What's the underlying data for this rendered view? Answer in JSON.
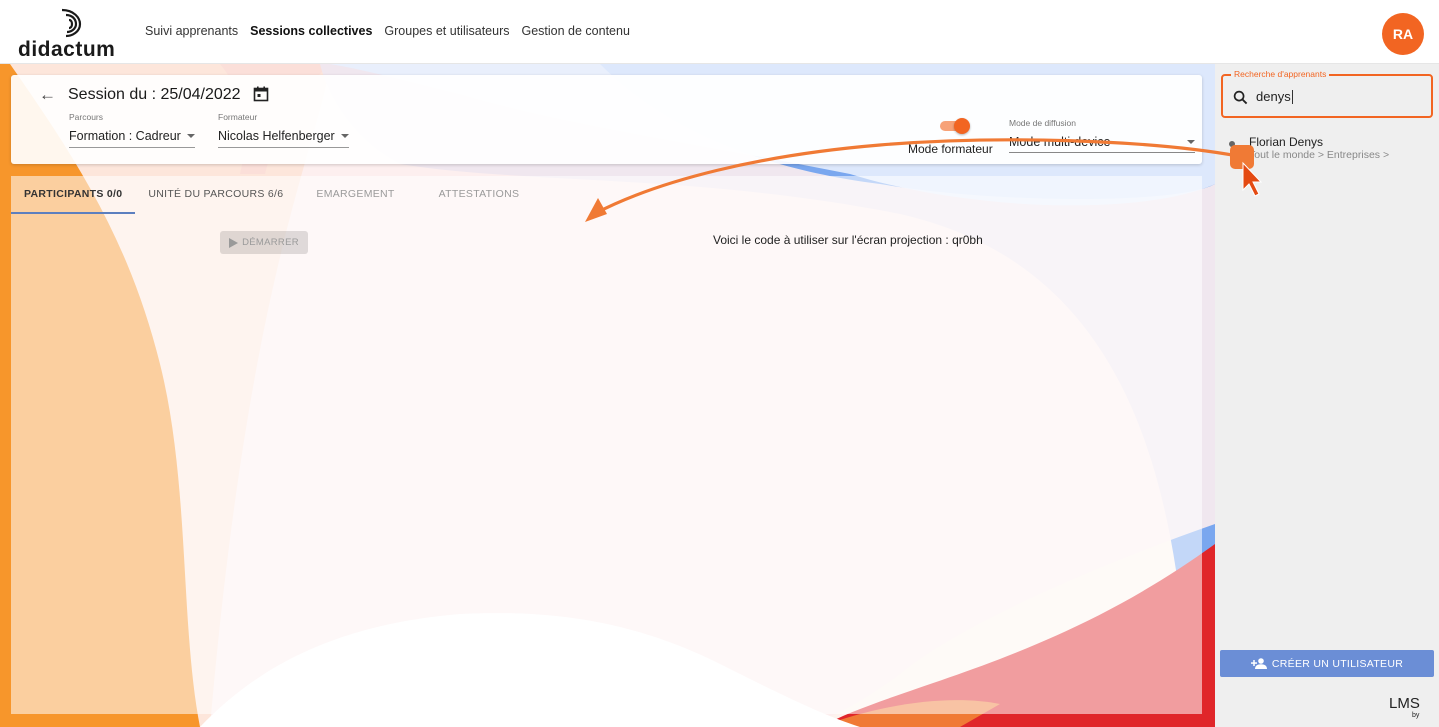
{
  "brand": {
    "name": "didactum"
  },
  "nav": {
    "items": [
      {
        "label": "Suivi apprenants",
        "active": false
      },
      {
        "label": "Sessions collectives",
        "active": true
      },
      {
        "label": "Groupes et utilisateurs",
        "active": false
      },
      {
        "label": "Gestion de contenu",
        "active": false
      }
    ]
  },
  "user": {
    "initials": "RA"
  },
  "session": {
    "title": "Session du : 25/04/2022",
    "parcours_label": "Parcours",
    "parcours_value": "Formation : Cadreur",
    "formateur_label": "Formateur",
    "formateur_value": "Nicolas Helfenberger",
    "toggle_label": "Mode formateur",
    "toggle_on": true,
    "diffusion_label": "Mode de diffusion",
    "diffusion_value": "Mode multi-device"
  },
  "tabs": [
    {
      "label": "PARTICIPANTS 0/0",
      "active": true
    },
    {
      "label": "UNITÉ DU PARCOURS 6/6",
      "active": false
    },
    {
      "label": "EMARGEMENT",
      "active": false
    },
    {
      "label": "ATTESTATIONS",
      "active": false
    }
  ],
  "main": {
    "start_label": "DÉMARRER",
    "code_text": "Voici le code à utiliser sur l'écran projection : qr0bh"
  },
  "sidebar": {
    "search_label": "Recherche d'apprenants",
    "search_value": "denys",
    "results": [
      {
        "name": "Florian Denys",
        "path": "Tout le monde > Entreprises >"
      }
    ],
    "create_label": "CRÉER UN UTILISATEUR",
    "footer_logo": "LMS",
    "footer_by": "by"
  },
  "colors": {
    "accent": "#f26522",
    "button_blue": "#6b8ed6",
    "tab_indicator": "#5c7fbf",
    "bg_orange": "#f7962b",
    "bg_blue": "#7aa7ef",
    "bg_red": "#e0262a"
  },
  "icons": [
    "back-arrow-icon",
    "calendar-icon",
    "caret-down-icon",
    "play-icon",
    "search-icon",
    "add-user-icon",
    "cursor-icon"
  ]
}
